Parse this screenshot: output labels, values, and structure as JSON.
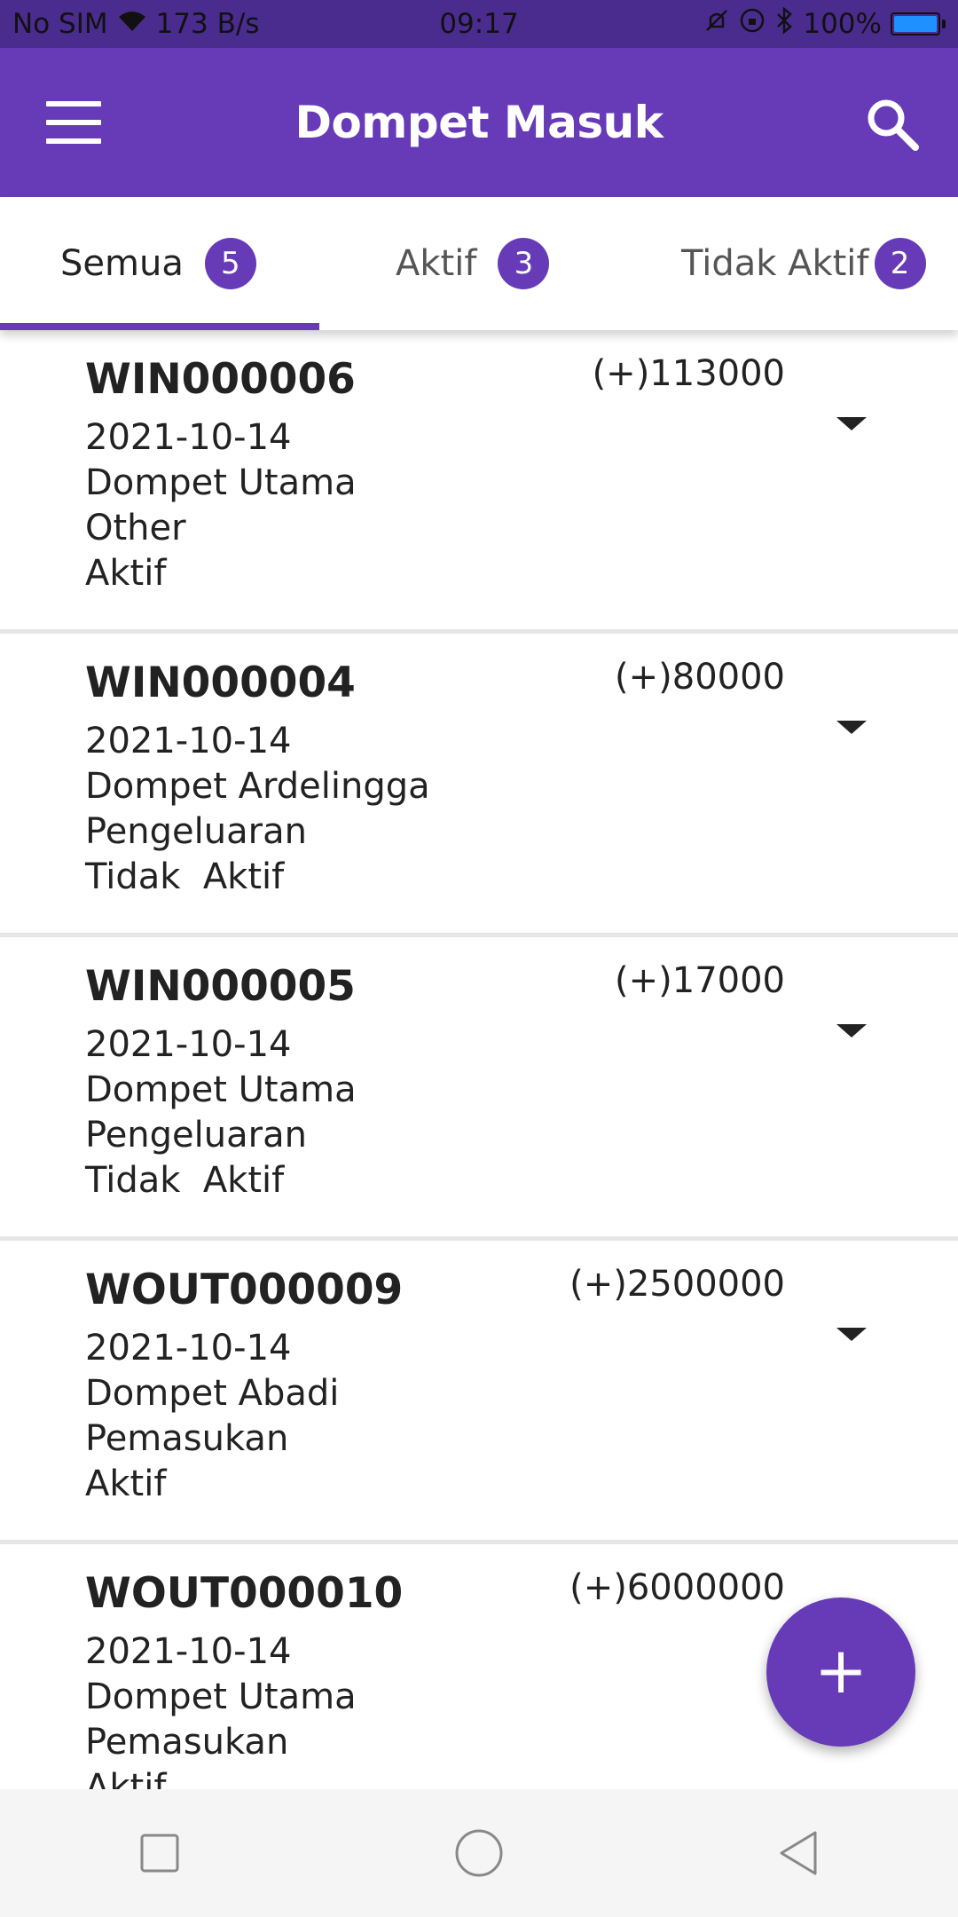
{
  "status_bar": {
    "carrier": "No SIM",
    "speed": "173 B/s",
    "time": "09:17",
    "battery": "100%"
  },
  "app_bar": {
    "title": "Dompet Masuk"
  },
  "tabs": [
    {
      "label": "Semua",
      "count": "5",
      "active": true
    },
    {
      "label": "Aktif",
      "count": "3",
      "active": false
    },
    {
      "label": "Tidak Aktif",
      "count": "2",
      "active": false
    }
  ],
  "items": [
    {
      "code": "WIN000006",
      "amount": "(+)113000",
      "date": "2021-10-14",
      "wallet": "Dompet Utama",
      "category": "Other",
      "status": "Aktif"
    },
    {
      "code": "WIN000004",
      "amount": "(+)80000",
      "date": "2021-10-14",
      "wallet": "Dompet Ardelingga",
      "category": "Pengeluaran",
      "status": "Tidak  Aktif"
    },
    {
      "code": "WIN000005",
      "amount": "(+)17000",
      "date": "2021-10-14",
      "wallet": "Dompet Utama",
      "category": "Pengeluaran",
      "status": "Tidak  Aktif"
    },
    {
      "code": "WOUT000009",
      "amount": "(+)2500000",
      "date": "2021-10-14",
      "wallet": "Dompet Abadi",
      "category": "Pemasukan",
      "status": "Aktif"
    },
    {
      "code": "WOUT000010",
      "amount": "(+)6000000",
      "date": "2021-10-14",
      "wallet": "Dompet Utama",
      "category": "Pemasukan",
      "status": "Aktif"
    }
  ],
  "fab": {
    "label": "+"
  },
  "colors": {
    "primary": "#673ab7",
    "status_bar": "#4a2c8f",
    "nav_bar": "#f5f5f5"
  }
}
